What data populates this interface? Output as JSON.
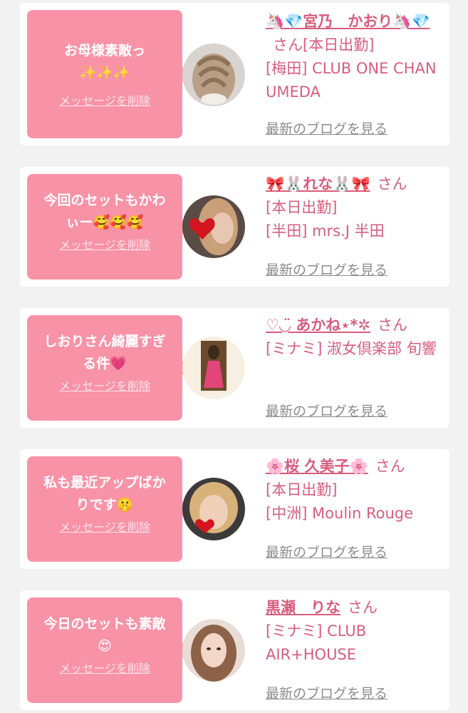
{
  "messages": [
    {
      "bubble_text": "お母様素敵っ✨✨✨",
      "delete_label": "メッセージを削除",
      "name": "🦄💎宮乃　かおり🦄💎",
      "honorific": "さん",
      "status": "[本日出勤]",
      "shop": "[梅田] CLUB ONE CHAN UMEDA",
      "blog_label": "最新のブログを見る",
      "avatar_icon": "braided-hair-photo-icon"
    },
    {
      "bubble_text": "今回のセットもかわぃー🥰🥰🥰",
      "delete_label": "メッセージを削除",
      "name": "🎀🐰れな🐰🎀",
      "honorific": "さん",
      "status": "[本日出勤]",
      "shop": "[半田] mrs.J 半田",
      "blog_label": "最新のブログを見る",
      "avatar_icon": "heart-sticker-portrait-icon"
    },
    {
      "bubble_text": "しおりさん綺麗すぎる件💗",
      "delete_label": "メッセージを削除",
      "name": "♡◡̈ あかね⋆*✲",
      "honorific": "さん",
      "status": "",
      "shop": "[ミナミ] 淑女倶楽部 旬響",
      "blog_label": "最新のブログを見る",
      "avatar_icon": "pink-dress-photo-icon"
    },
    {
      "bubble_text": "私も最近アップばかりです🤫",
      "delete_label": "メッセージを削除",
      "name": "🌸桜 久美子🌸",
      "honorific": "さん",
      "status": "[本日出勤]",
      "shop": "[中洲] Moulin Rouge",
      "blog_label": "最新のブログを見る",
      "avatar_icon": "selfie-heart-portrait-icon"
    },
    {
      "bubble_text": "今日のセットも素敵😍",
      "delete_label": "メッセージを削除",
      "name": "黒瀬　りな",
      "honorific": "さん",
      "status": "",
      "shop": "[ミナミ] CLUB AIR+HOUSE",
      "blog_label": "最新のブログを見る",
      "avatar_icon": "wavy-hair-portrait-icon"
    }
  ],
  "colors": {
    "bubble": "#f893a7",
    "accent_text": "#d85d7d",
    "blog_link": "#8c8c8c",
    "page_bg": "#f2f2f2"
  }
}
